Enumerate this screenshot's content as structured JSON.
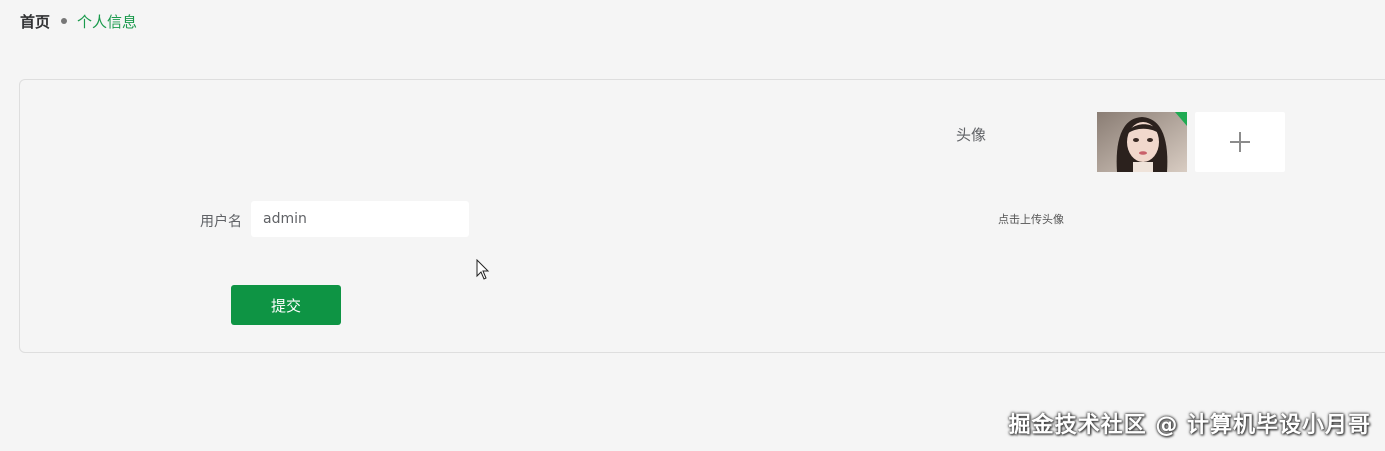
{
  "breadcrumb": {
    "home": "首页",
    "current": "个人信息"
  },
  "form": {
    "username_label": "用户名",
    "username_value": "admin",
    "avatar_label": "头像",
    "upload_tip": "点击上传头像",
    "submit_label": "提交"
  },
  "colors": {
    "accent": "#0e9444",
    "breadcrumb_active": "#1a9a4c",
    "background": "#f5f5f5"
  },
  "icons": {
    "upload": "plus-icon",
    "cursor": "mouse-pointer-icon"
  },
  "watermark": "掘金技术社区 @ 计算机毕设小月哥"
}
